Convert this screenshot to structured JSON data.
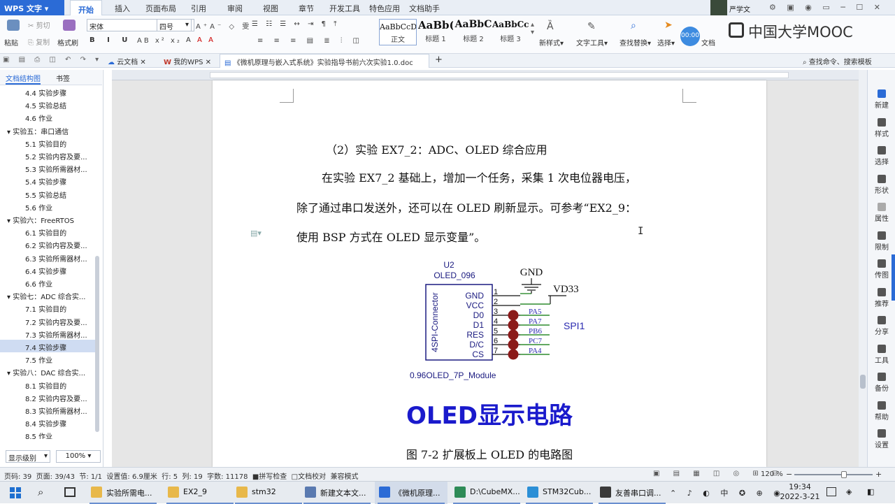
{
  "app": {
    "name": "WPS 文字",
    "user": "严学文",
    "menu_tabs": [
      "开始",
      "插入",
      "页面布局",
      "引用",
      "审阅",
      "视图",
      "章节",
      "开发工具",
      "特色应用",
      "文档助手"
    ],
    "mooc_logo": "中国大学MOOC",
    "timer_badge": "00:00"
  },
  "ribbon": {
    "paste": "粘贴",
    "cut": "剪切",
    "copy": "复制",
    "format_painter": "格式刷",
    "font_name": "宋体",
    "font_size": "四号",
    "styles": [
      {
        "sample": "AaBbCcD",
        "label": "正文"
      },
      {
        "sample": "AaBb(",
        "label": "标题 1"
      },
      {
        "sample": "AaBbC",
        "label": "标题 2"
      },
      {
        "sample": "AaBbCc",
        "label": "标题 3"
      }
    ],
    "new_style": "新样式",
    "text_tools": "文字工具",
    "find_replace": "查找替换",
    "select": "选择",
    "doc_label": "文档"
  },
  "quickbar": {
    "cloud_docs": "云文档",
    "my_wps": "我的WPS",
    "doc_tab": "《微机原理与嵌入式系统》实验指导书前六次实验1.0.doc",
    "command_search": "查找命令、搜索模板"
  },
  "left_panel": {
    "tab_outline": "文档结构图",
    "tab_bookmark": "书签",
    "items": [
      {
        "text": "4.4 实验步骤",
        "level": 2
      },
      {
        "text": "4.5 实验总结",
        "level": 2
      },
      {
        "text": "4.6 作业",
        "level": 2
      },
      {
        "text": "实验五：串口通信",
        "level": 1
      },
      {
        "text": "5.1 实验目的",
        "level": 2
      },
      {
        "text": "5.2 实验内容及要...",
        "level": 2
      },
      {
        "text": "5.3 实验所需器材...",
        "level": 2
      },
      {
        "text": "5.4 实验步骤",
        "level": 2
      },
      {
        "text": "5.5 实验总结",
        "level": 2
      },
      {
        "text": "5.6 作业",
        "level": 2
      },
      {
        "text": "实验六：FreeRTOS",
        "level": 1
      },
      {
        "text": "6.1 实验目的",
        "level": 2
      },
      {
        "text": "6.2 实验内容及要...",
        "level": 2
      },
      {
        "text": "6.3 实验所需器材...",
        "level": 2
      },
      {
        "text": "6.4 实验步骤",
        "level": 2
      },
      {
        "text": "6.6 作业",
        "level": 2
      },
      {
        "text": "实验七：ADC 综合实...",
        "level": 1
      },
      {
        "text": "7.1 实验目的",
        "level": 2
      },
      {
        "text": "7.2 实验内容及要...",
        "level": 2
      },
      {
        "text": "7.3 实验所需器材...",
        "level": 2
      },
      {
        "text": "7.4 实验步骤",
        "level": 2,
        "selected": true
      },
      {
        "text": "7.5 作业",
        "level": 2
      },
      {
        "text": "实验八：DAC 综合实...",
        "level": 1
      },
      {
        "text": "8.1 实验目的",
        "level": 2
      },
      {
        "text": "8.2 实验内容及要...",
        "level": 2
      },
      {
        "text": "8.3 实验所需器材...",
        "level": 2
      },
      {
        "text": "8.4 实验步骤",
        "level": 2
      },
      {
        "text": "8.5 作业",
        "level": 2
      }
    ],
    "display_level": "显示级别",
    "zoom": "100%"
  },
  "document": {
    "heading": "（2）实验 EX7_2：ADC、OLED 综合应用",
    "para_line1": "在实验 EX7_2 基础上，增加一个任务，采集 1 次电位器电压，",
    "para_line2": "除了通过串口发送外，还可以在 OLED 刷新显示。可参考“EX2_9：",
    "para_line3": "使用 BSP 方式在 OLED 显示变量”。",
    "figure": {
      "ref": "U2",
      "part": "OLED_096",
      "gnd": "GND",
      "vdd": "VD33",
      "connector": "4SPI-Connector",
      "pins": [
        {
          "name": "GND",
          "num": "1",
          "net": ""
        },
        {
          "name": "VCC",
          "num": "2",
          "net": ""
        },
        {
          "name": "D0",
          "num": "3",
          "net": "PA5"
        },
        {
          "name": "D1",
          "num": "4",
          "net": "PA7"
        },
        {
          "name": "RES",
          "num": "5",
          "net": "PB6"
        },
        {
          "name": "D/C",
          "num": "6",
          "net": "PC7"
        },
        {
          "name": "CS",
          "num": "7",
          "net": "PA4"
        }
      ],
      "bus": "SPI1",
      "module": "0.96OLED_7P_Module",
      "big_title": "OLED显示电路"
    },
    "caption": "图 7-2 扩展板上 OLED 的电路图",
    "colors": {
      "title_blue": "#1a1acc",
      "wire_green": "#2e8b2e",
      "junction_red": "#8b1a1a",
      "net_blue": "#2a2ab0"
    }
  },
  "right_panel": [
    "新建",
    "样式",
    "选择",
    "形状",
    "属性",
    "限制",
    "传图",
    "推荐",
    "分享",
    "工具",
    "备份",
    "帮助",
    "设置"
  ],
  "status": {
    "page_code": "页码: 39",
    "pages": "页面: 39/43",
    "section": "节: 1/1",
    "setting": "设置值: 6.9厘米",
    "row": "行: 5",
    "col": "列: 19",
    "chars": "字数: 11178",
    "spell": "拼写检查",
    "proof": "文档校对",
    "compat": "兼容模式",
    "zoom": "120 %"
  },
  "taskbar": {
    "items": [
      "实验所需电...",
      "EX2_9",
      "stm32",
      "新建文本文...",
      "《微机原理...",
      "D:\\CubeMX...",
      "STM32Cub...",
      "友善串口调..."
    ],
    "time": "19:34",
    "date": "2022-3-21"
  }
}
